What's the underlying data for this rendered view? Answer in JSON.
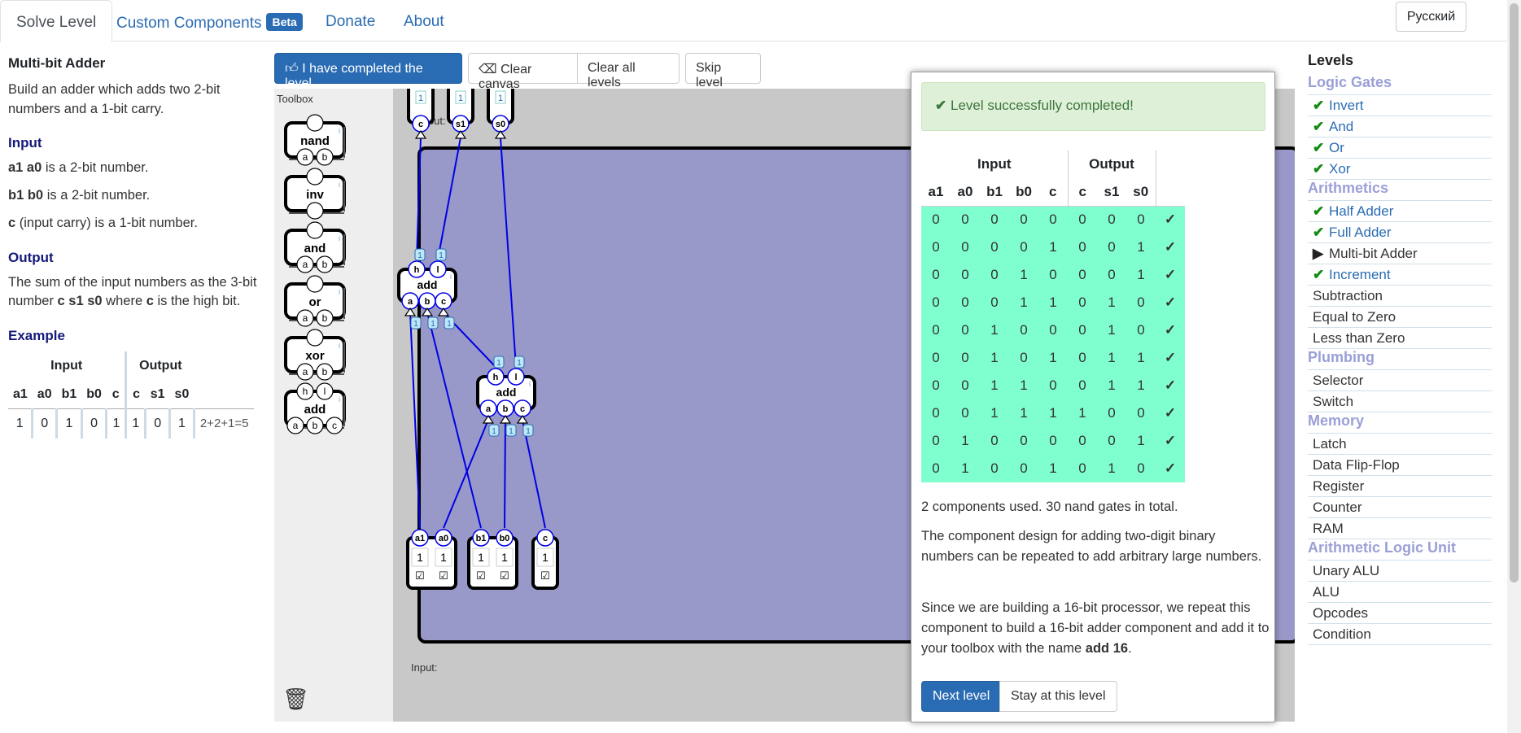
{
  "nav": {
    "tabs": [
      "Solve Level",
      "Custom Components",
      "Donate",
      "About"
    ],
    "beta": "Beta",
    "language": "Русский"
  },
  "level": {
    "title": "Multi-bit Adder",
    "description": "Build an adder which adds two 2-bit numbers and a 1-bit carry.",
    "input_heading": "Input",
    "input_a": {
      "bold": "a1 a0",
      "rest": " is a 2-bit number."
    },
    "input_b": {
      "bold": "b1 b0",
      "rest": " is a 2-bit number."
    },
    "input_c": {
      "bold": "c",
      "rest": " (input carry) is a 1-bit number."
    },
    "output_heading": "Output",
    "output_text_1": "The sum of the input numbers as the 3-bit number ",
    "output_bold_1": "c s1 s0",
    "output_text_2": " where ",
    "output_bold_2": "c",
    "output_text_3": " is the high bit.",
    "example_heading": "Example",
    "example_group_input": "Input",
    "example_group_output": "Output",
    "example_headers": [
      "a1",
      "a0",
      "b1",
      "b0",
      "c",
      "c",
      "s1",
      "s0"
    ],
    "example_row": [
      "1",
      "0",
      "1",
      "0",
      "1",
      "1",
      "0",
      "1"
    ],
    "example_note": "2+2+1=5"
  },
  "toolbar": {
    "completed": "I have completed the level",
    "clear_canvas": "Clear canvas",
    "clear_all": "Clear all levels",
    "skip": "Skip level"
  },
  "toolbox": {
    "title": "Toolbox",
    "components": [
      {
        "name": "nand",
        "pins": [
          "a",
          "b"
        ],
        "outs": [
          ""
        ]
      },
      {
        "name": "inv",
        "pins": [
          ""
        ],
        "outs": [
          ""
        ]
      },
      {
        "name": "and",
        "pins": [
          "a",
          "b"
        ],
        "outs": [
          ""
        ]
      },
      {
        "name": "or",
        "pins": [
          "a",
          "b"
        ],
        "outs": [
          ""
        ]
      },
      {
        "name": "xor",
        "pins": [
          "a",
          "b"
        ],
        "outs": [
          ""
        ]
      },
      {
        "name": "add",
        "pins": [
          "a",
          "b",
          "c"
        ],
        "outs": [
          "h",
          "l"
        ]
      }
    ]
  },
  "canvas": {
    "output_label": "Output:",
    "input_label": "Input:",
    "outputs": [
      {
        "name": "c",
        "value": "1"
      },
      {
        "name": "s1",
        "value": "1"
      },
      {
        "name": "s0",
        "value": "1"
      }
    ],
    "inputs": [
      {
        "name": "a1",
        "value": "1"
      },
      {
        "name": "a0",
        "value": "1"
      },
      {
        "name": "b1",
        "value": "1"
      },
      {
        "name": "b0",
        "value": "1"
      },
      {
        "name": "c",
        "value": "1"
      }
    ],
    "add_label": "add",
    "wire_value": "1",
    "checkbox": "☑",
    "colors": {
      "board": "#9999c9",
      "wire": "#0000e6",
      "value_box": "#bde7f7"
    }
  },
  "result": {
    "success": "Level successfully completed!",
    "group_input": "Input",
    "group_output": "Output",
    "headers": [
      "a1",
      "a0",
      "b1",
      "b0",
      "c",
      "c",
      "s1",
      "s0"
    ],
    "rows": [
      [
        "0",
        "0",
        "0",
        "0",
        "0",
        "0",
        "0",
        "0"
      ],
      [
        "0",
        "0",
        "0",
        "0",
        "1",
        "0",
        "0",
        "1"
      ],
      [
        "0",
        "0",
        "0",
        "1",
        "0",
        "0",
        "0",
        "1"
      ],
      [
        "0",
        "0",
        "0",
        "1",
        "1",
        "0",
        "1",
        "0"
      ],
      [
        "0",
        "0",
        "1",
        "0",
        "0",
        "0",
        "1",
        "0"
      ],
      [
        "0",
        "0",
        "1",
        "0",
        "1",
        "0",
        "1",
        "1"
      ],
      [
        "0",
        "0",
        "1",
        "1",
        "0",
        "0",
        "1",
        "1"
      ],
      [
        "0",
        "0",
        "1",
        "1",
        "1",
        "1",
        "0",
        "0"
      ],
      [
        "0",
        "1",
        "0",
        "0",
        "0",
        "0",
        "0",
        "1"
      ],
      [
        "0",
        "1",
        "0",
        "0",
        "1",
        "0",
        "1",
        "0"
      ]
    ],
    "check": "✓",
    "summary": "2 components used. 30 nand gates in total.",
    "para1": "The component design for adding two-digit binary numbers can be repeated to add arbitrary large numbers.",
    "para2a": "Since we are building a 16-bit processor, we repeat this component to build a 16-bit adder component and add it to your toolbox with the name ",
    "para2b": "add 16",
    "para2c": ".",
    "next": "Next level",
    "stay": "Stay at this level",
    "row_color": "#7fffd0"
  },
  "levels": {
    "title": "Levels",
    "groups": [
      {
        "name": "Logic Gates",
        "items": [
          {
            "label": "Invert",
            "status": "done"
          },
          {
            "label": "And",
            "status": "done"
          },
          {
            "label": "Or",
            "status": "done"
          },
          {
            "label": "Xor",
            "status": "done"
          }
        ]
      },
      {
        "name": "Arithmetics",
        "items": [
          {
            "label": "Half Adder",
            "status": "done"
          },
          {
            "label": "Full Adder",
            "status": "done"
          },
          {
            "label": "Multi-bit Adder",
            "status": "current"
          },
          {
            "label": "Increment",
            "status": "done"
          },
          {
            "label": "Subtraction",
            "status": "todo"
          },
          {
            "label": "Equal to Zero",
            "status": "todo"
          },
          {
            "label": "Less than Zero",
            "status": "todo"
          }
        ]
      },
      {
        "name": "Plumbing",
        "items": [
          {
            "label": "Selector",
            "status": "todo"
          },
          {
            "label": "Switch",
            "status": "todo"
          }
        ]
      },
      {
        "name": "Memory",
        "items": [
          {
            "label": "Latch",
            "status": "todo"
          },
          {
            "label": "Data Flip-Flop",
            "status": "todo"
          },
          {
            "label": "Register",
            "status": "todo"
          },
          {
            "label": "Counter",
            "status": "todo"
          },
          {
            "label": "RAM",
            "status": "todo"
          }
        ]
      },
      {
        "name": "Arithmetic Logic Unit",
        "items": [
          {
            "label": "Unary ALU",
            "status": "todo"
          },
          {
            "label": "ALU",
            "status": "todo"
          },
          {
            "label": "Opcodes",
            "status": "todo"
          },
          {
            "label": "Condition",
            "status": "todo"
          }
        ]
      }
    ]
  }
}
